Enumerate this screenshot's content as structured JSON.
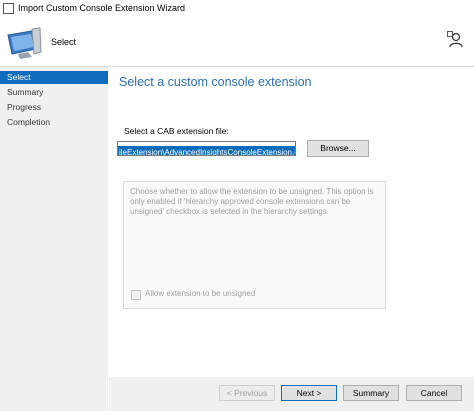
{
  "window": {
    "title": "Import Custom Console Extension Wizard"
  },
  "header": {
    "step_title": "Select"
  },
  "sidebar": {
    "items": [
      {
        "label": "Select",
        "active": true
      },
      {
        "label": "Summary",
        "active": false
      },
      {
        "label": "Progress",
        "active": false
      },
      {
        "label": "Completion",
        "active": false
      }
    ]
  },
  "main": {
    "title": "Select a custom console extension",
    "cab_label": "Select a CAB extension file:",
    "cab_value": "ileExtension\\AdvancedInsightsConsoleExtension.cab",
    "browse_label": "Browse...",
    "unsigned_description": "Choose whether to allow the extension to be unsigned. This option is only enabled if 'hierarchy approved console extensions can be unsigned' checkbox is selected in the hierarchy settings",
    "unsigned_checkbox_label": "Allow extension to be unsigned",
    "unsigned_checked": false
  },
  "footer": {
    "previous_label": "< Previous",
    "next_label": "Next >",
    "summary_label": "Summary",
    "cancel_label": "Cancel"
  },
  "colors": {
    "accent": "#0f6cbd",
    "title_blue": "#2f6fb0"
  },
  "icons": {
    "app": "wizard-app-icon",
    "header": "computer-monitor-icon",
    "help": "user-help-icon"
  }
}
